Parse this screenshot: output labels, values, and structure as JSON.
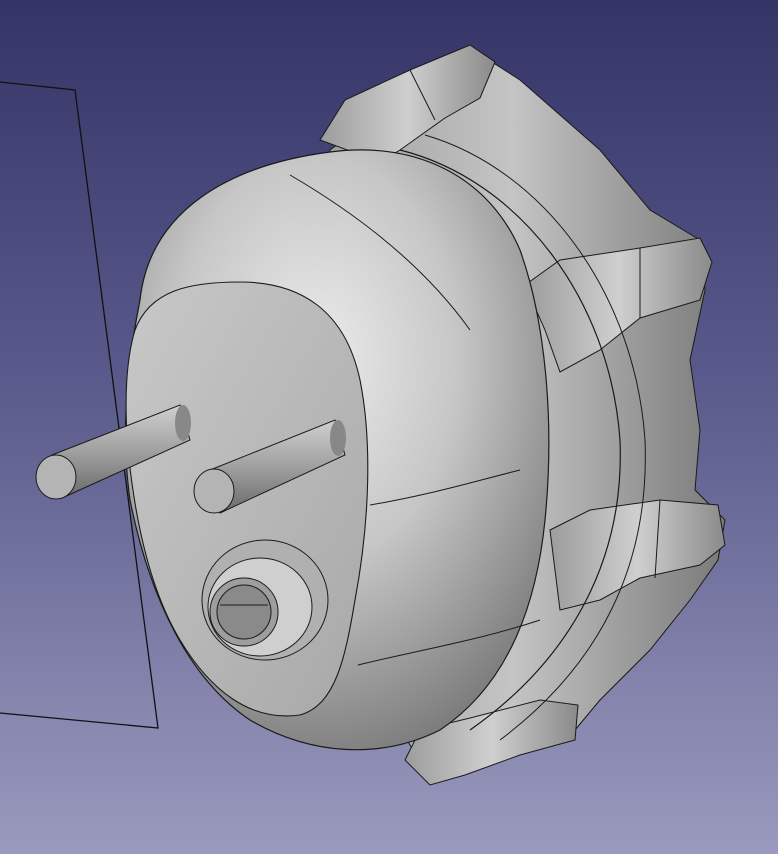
{
  "viewport": {
    "background_top": "#343466",
    "background_bottom": "#9a9abe"
  },
  "model": {
    "object": "motor-housing",
    "shaded_color": "#b8b8b8",
    "edge_color": "#1a1a1a"
  }
}
